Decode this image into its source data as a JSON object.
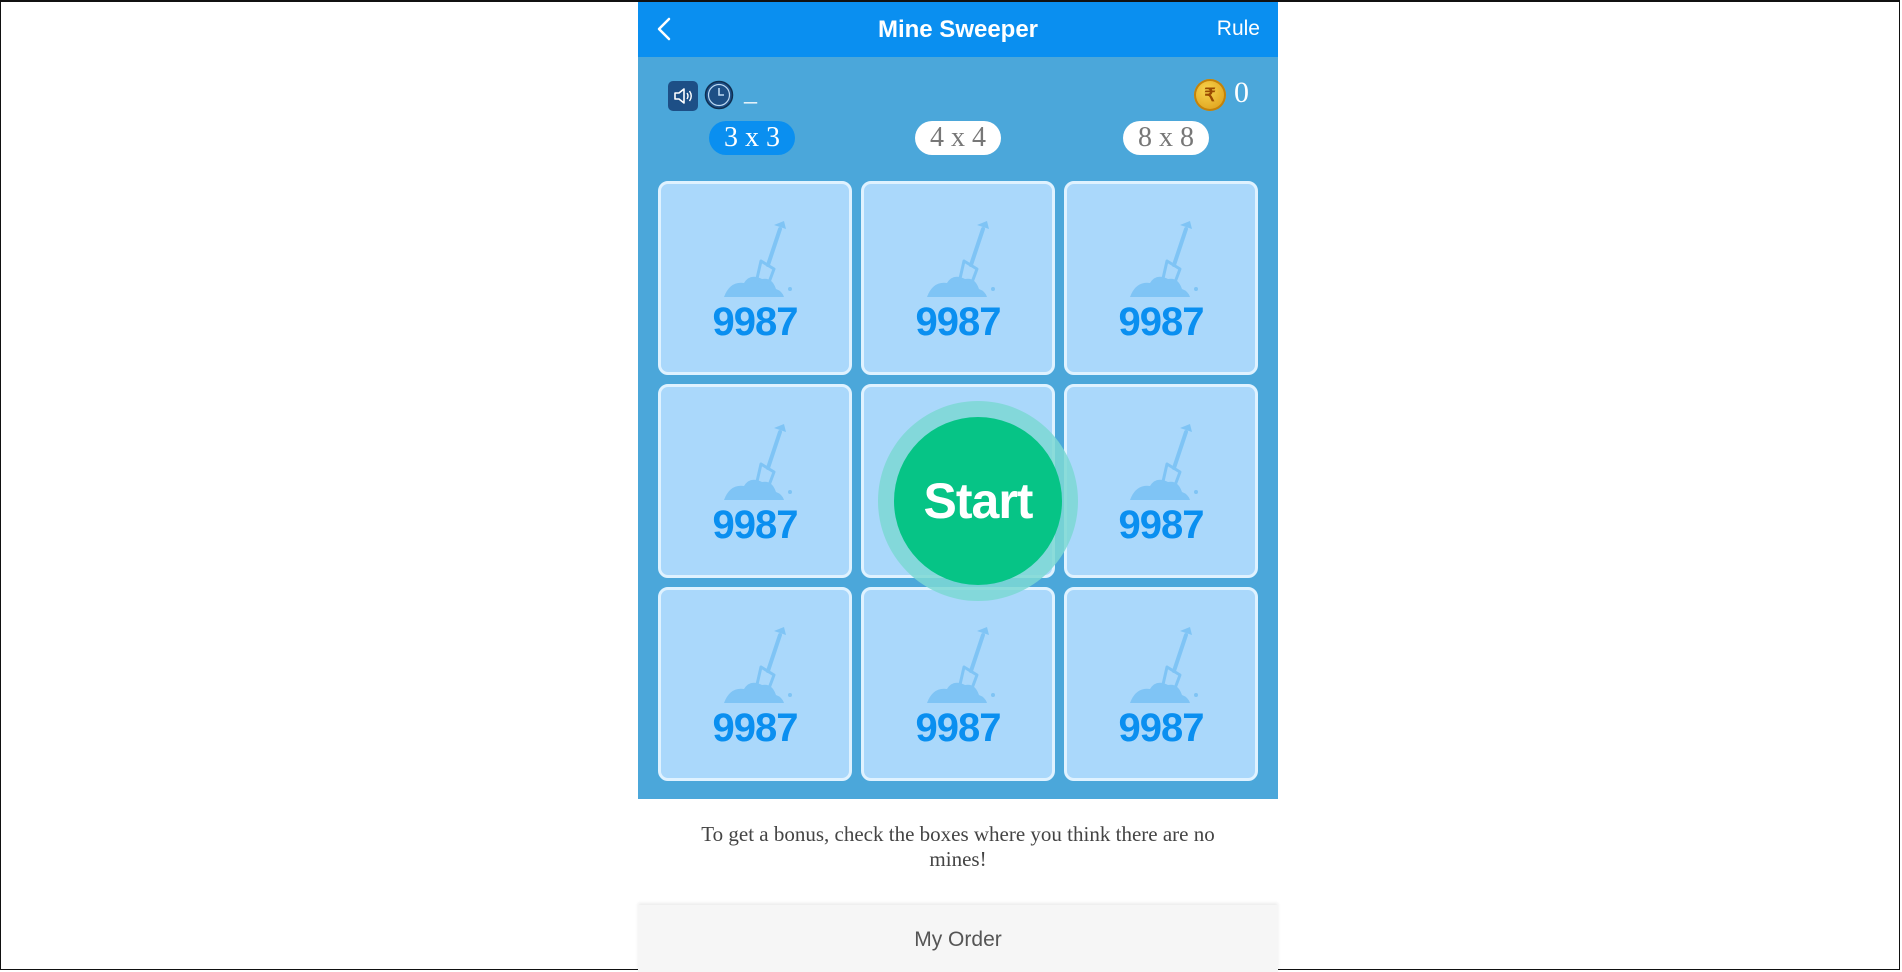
{
  "header": {
    "title": "Mine Sweeper",
    "rule_label": "Rule"
  },
  "status": {
    "timer": "_",
    "coins": "0",
    "coin_symbol": "₹"
  },
  "board_sizes": [
    {
      "label": "3 x 3",
      "selected": true
    },
    {
      "label": "4 x 4",
      "selected": false
    },
    {
      "label": "8 x 8",
      "selected": false
    }
  ],
  "cells": [
    {
      "value": "9987"
    },
    {
      "value": "9987"
    },
    {
      "value": "9987"
    },
    {
      "value": "9987"
    },
    {
      "value": "9987"
    },
    {
      "value": "9987"
    },
    {
      "value": "9987"
    },
    {
      "value": "9987"
    }
  ],
  "start_label": "Start",
  "hint": "To get a bonus, check the boxes where you think there are no mines!",
  "footer": {
    "my_order_label": "My Order"
  },
  "colors": {
    "header_blue": "#0a8ff0",
    "board_blue": "#4ba7da",
    "cell_blue": "#aad8fb",
    "start_green": "#06c486"
  },
  "icons": [
    "back-arrow-icon",
    "sound-icon",
    "clock-icon",
    "rupee-coin-icon",
    "shovel-icon"
  ]
}
